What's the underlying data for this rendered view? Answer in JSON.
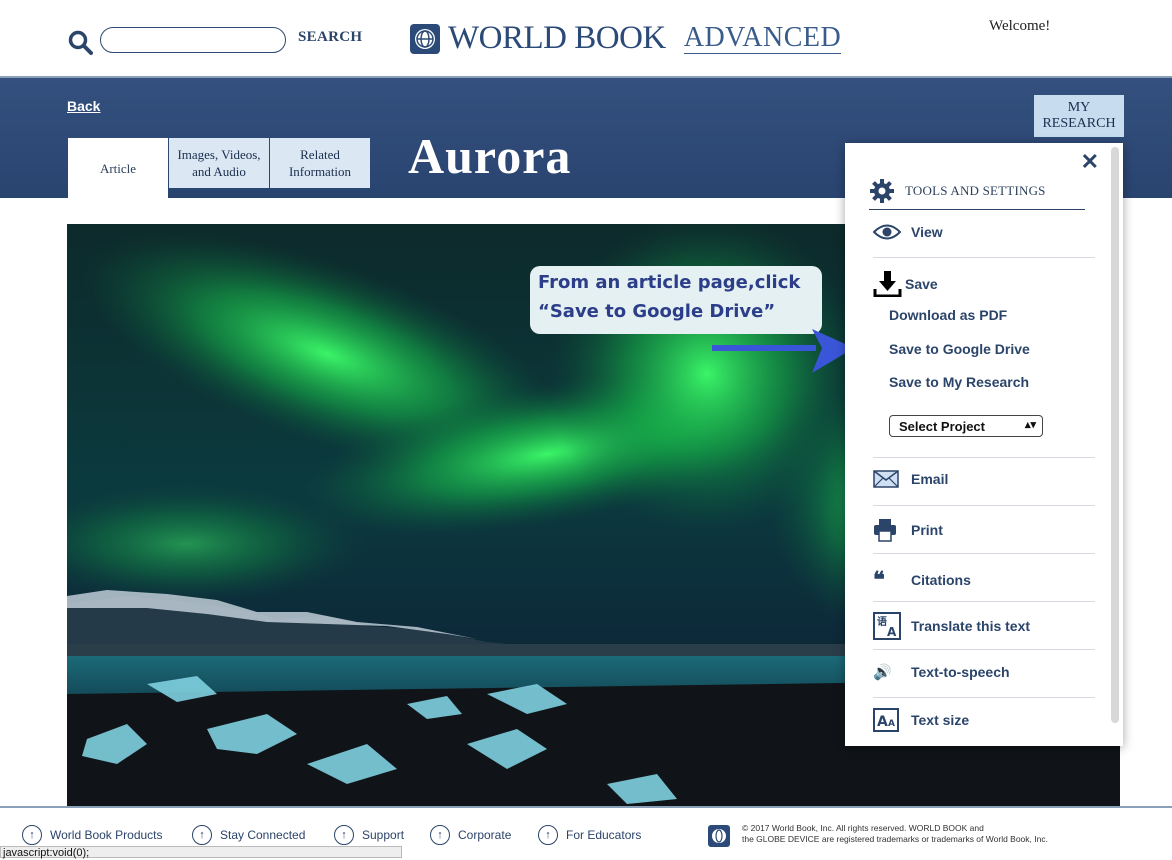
{
  "header": {
    "search_button": "SEARCH",
    "search_placeholder": "",
    "logo_text": "WORLD BOOK",
    "logo_edition": "ADVANCED",
    "welcome": "Welcome!"
  },
  "hero": {
    "back": "Back",
    "my_research": "MY RESEARCH",
    "title": "Aurora",
    "tabs": [
      {
        "label": "Article"
      },
      {
        "label": "Images, Videos, and Audio"
      },
      {
        "label": "Related Information"
      }
    ]
  },
  "panel": {
    "heading": "TOOLS AND SETTINGS",
    "view": "View",
    "save": "Save",
    "save_options": [
      "Download as PDF",
      "Save to Google Drive",
      "Save to My Research"
    ],
    "select_project": "Select Project",
    "items": [
      {
        "label": "Email",
        "icon": "envelope-icon"
      },
      {
        "label": "Print",
        "icon": "printer-icon"
      },
      {
        "label": "Citations",
        "icon": "quote-icon"
      },
      {
        "label": "Translate this text",
        "icon": "translate-icon"
      },
      {
        "label": "Text-to-speech",
        "icon": "speaker-icon"
      },
      {
        "label": "Text size",
        "icon": "text-size-icon"
      }
    ]
  },
  "callout": {
    "line1": "From an article page,click",
    "line2": "“Save to Google Drive”"
  },
  "footer": {
    "links": [
      "World Book Products",
      "Stay Connected",
      "Support",
      "Corporate",
      "For Educators"
    ],
    "copyright_line1": "© 2017 World Book, Inc. All rights reserved. WORLD BOOK and",
    "copyright_line2": "the GLOBE DEVICE are registered trademarks or trademarks of World Book, Inc."
  },
  "statusbar": "javascript:void(0);",
  "colors": {
    "brand": "#2b446a",
    "hero": "#2f4b78",
    "callout_text": "#2c3e8a",
    "arrow": "#3a56d8"
  }
}
